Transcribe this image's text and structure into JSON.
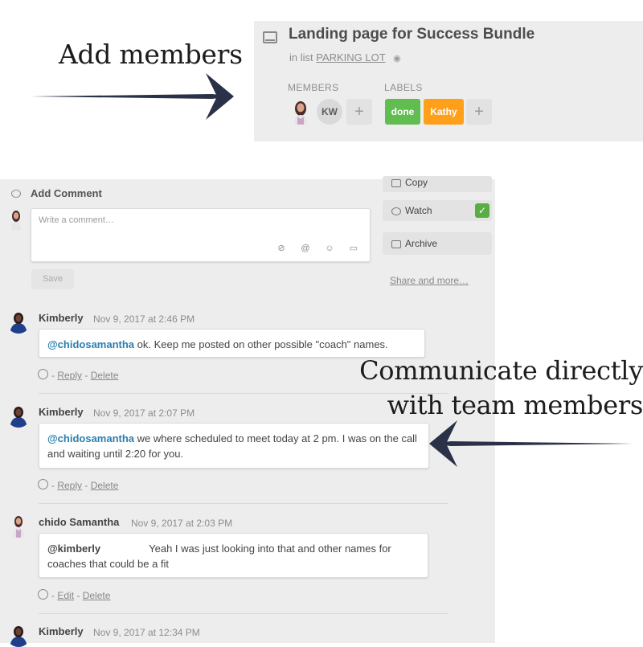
{
  "annotations": {
    "add_members": "Add members",
    "communicate_line1": "Communicate directly",
    "communicate_line2": "with team members"
  },
  "card": {
    "title": "Landing page for Success Bundle",
    "in_list_prefix": "in list",
    "list_name": "PARKING LOT",
    "members_heading": "MEMBERS",
    "labels_heading": "LABELS",
    "member_initials": "KW",
    "add_symbol": "+",
    "labels": [
      {
        "text": "done",
        "color": "#61bd4f"
      },
      {
        "text": "Kathy",
        "color": "#ff9f1a"
      }
    ]
  },
  "comment_form": {
    "title": "Add Comment",
    "placeholder": "Write a comment…",
    "tools": [
      "attachment-icon",
      "mention-icon",
      "emoji-icon",
      "card-icon"
    ],
    "save_label": "Save"
  },
  "sidebar": {
    "copy_label": "Copy",
    "watch_label": "Watch",
    "watch_check": "✓",
    "archive_label": "Archive",
    "share_label": "Share and more…"
  },
  "comments": [
    {
      "author": "Kimberly",
      "time": "Nov 9, 2017 at 2:46 PM",
      "mention": "@chidosamantha",
      "text": " ok. Keep me posted on other possible \"coach\" names.",
      "actions": [
        "Reply",
        "Delete"
      ]
    },
    {
      "author": "Kimberly",
      "time": "Nov 9, 2017 at 2:07 PM",
      "mention": "@chidosamantha",
      "text": " we where scheduled to meet today at 2 pm. I was on the call and waiting until 2:20 for you.",
      "actions": [
        "Reply",
        "Delete"
      ]
    },
    {
      "author": "chido Samantha",
      "time": "Nov 9, 2017 at 2:03 PM",
      "mention": "@kimberly",
      "text": "Yeah I was just looking into that and other names for coaches that could be a fit",
      "actions": [
        "Edit",
        "Delete"
      ]
    },
    {
      "author": "Kimberly",
      "time": "Nov 9, 2017 at 12:34 PM"
    }
  ],
  "colors": {
    "accent_blue": "#2a7fb0",
    "label_green": "#61bd4f",
    "label_orange": "#ff9f1a",
    "watch_green": "#5aac44",
    "arrow_navy": "#2b3247"
  }
}
